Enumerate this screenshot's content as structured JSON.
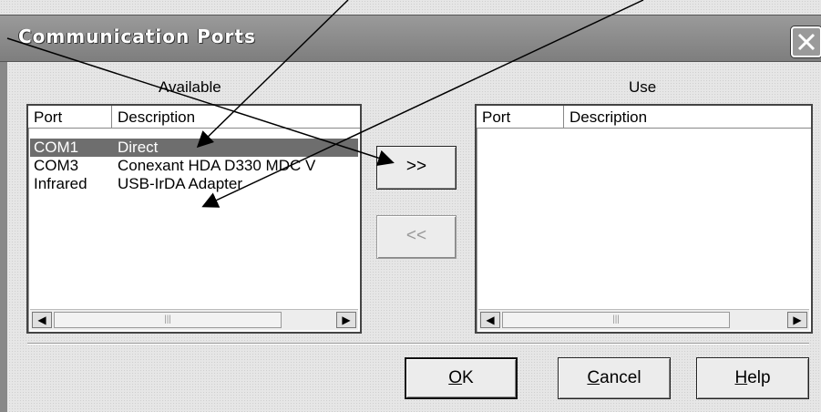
{
  "window": {
    "title": "Communication Ports"
  },
  "available": {
    "caption": "Available",
    "columns": [
      "Port",
      "Description"
    ],
    "rows": [
      {
        "port": "COM1",
        "description": "Direct",
        "selected": true
      },
      {
        "port": "COM3",
        "description": "Conexant HDA D330 MDC V",
        "selected": false
      },
      {
        "port": "Infrared",
        "description": "USB-IrDA Adapter",
        "selected": false
      }
    ]
  },
  "use": {
    "caption": "Use",
    "columns": [
      "Port",
      "Description"
    ],
    "rows": []
  },
  "buttons": {
    "add": ">>",
    "remove": "<<",
    "ok": {
      "accel": "O",
      "rest": "K"
    },
    "cancel": {
      "accel": "C",
      "rest": "ancel"
    },
    "help": {
      "accel": "H",
      "rest": "elp"
    }
  },
  "colors": {
    "selection": "#6e6e6e",
    "titlebar": "#8c8c8c",
    "annotation_arrows": "#000000"
  }
}
